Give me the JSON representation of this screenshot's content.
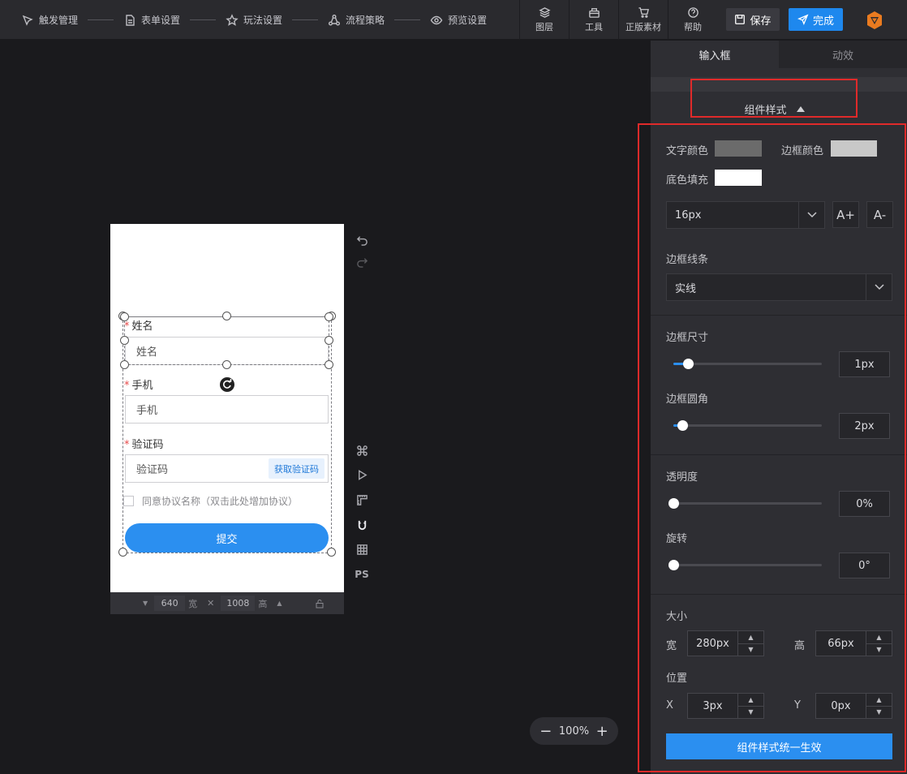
{
  "topbar": {
    "steps": [
      {
        "label": "触发管理",
        "icon": "trigger-icon"
      },
      {
        "label": "表单设置",
        "icon": "form-icon"
      },
      {
        "label": "玩法设置",
        "icon": "play-icon"
      },
      {
        "label": "流程策略",
        "icon": "flow-icon"
      },
      {
        "label": "预览设置",
        "icon": "eye-icon"
      }
    ],
    "tools": [
      {
        "label": "图层",
        "icon": "layers-icon"
      },
      {
        "label": "工具",
        "icon": "toolbox-icon"
      },
      {
        "label": "正版素材",
        "icon": "cart-icon"
      },
      {
        "label": "帮助",
        "icon": "help-icon"
      }
    ],
    "save_label": "保存",
    "done_label": "完成"
  },
  "form": {
    "name_label": "姓名",
    "name_placeholder": "姓名",
    "phone_label": "手机",
    "phone_placeholder": "手机",
    "code_label": "验证码",
    "code_placeholder": "验证码",
    "get_code_label": "获取验证码",
    "required_mark": "*",
    "agree_text": "同意协议名称（双击此处增加协议）",
    "submit_label": "提交"
  },
  "canvas_footer": {
    "width_value": "640",
    "width_unit": "宽",
    "height_value": "1008",
    "height_unit": "高",
    "times": "✕"
  },
  "side_tools": {
    "ps_label": "PS"
  },
  "zoom": {
    "value": "100%",
    "minus": "−",
    "plus": "+"
  },
  "panel": {
    "tabs": [
      "输入框",
      "动效"
    ],
    "section_title": "组件样式",
    "text_color_label": "文字颜色",
    "border_color_label": "边框颜色",
    "fill_label": "底色填充",
    "font_size": "16px",
    "font_up": "A+",
    "font_down": "A-",
    "border_line_label": "边框线条",
    "border_line_value": "实线",
    "border_size_label": "边框尺寸",
    "border_size_value": "1px",
    "border_radius_label": "边框圆角",
    "border_radius_value": "2px",
    "opacity_label": "透明度",
    "opacity_value": "0%",
    "rotate_label": "旋转",
    "rotate_value": "0°",
    "size_label": "大小",
    "w_label": "宽",
    "w_value": "280px",
    "h_label": "高",
    "h_value": "66px",
    "pos_label": "位置",
    "x_label": "X",
    "x_value": "3px",
    "y_label": "Y",
    "y_value": "0px",
    "apply_label": "组件样式统一生效"
  },
  "colors": {
    "text_color": "#6b6b6b",
    "border_color": "#c8c8c8",
    "fill_color": "#ffffff",
    "accent": "#2b8ff0",
    "highlight": "#e02a2a"
  },
  "sliders": {
    "border_size_fraction": 0.1,
    "border_radius_fraction": 0.06,
    "opacity_fraction": 0,
    "rotate_fraction": 0
  }
}
